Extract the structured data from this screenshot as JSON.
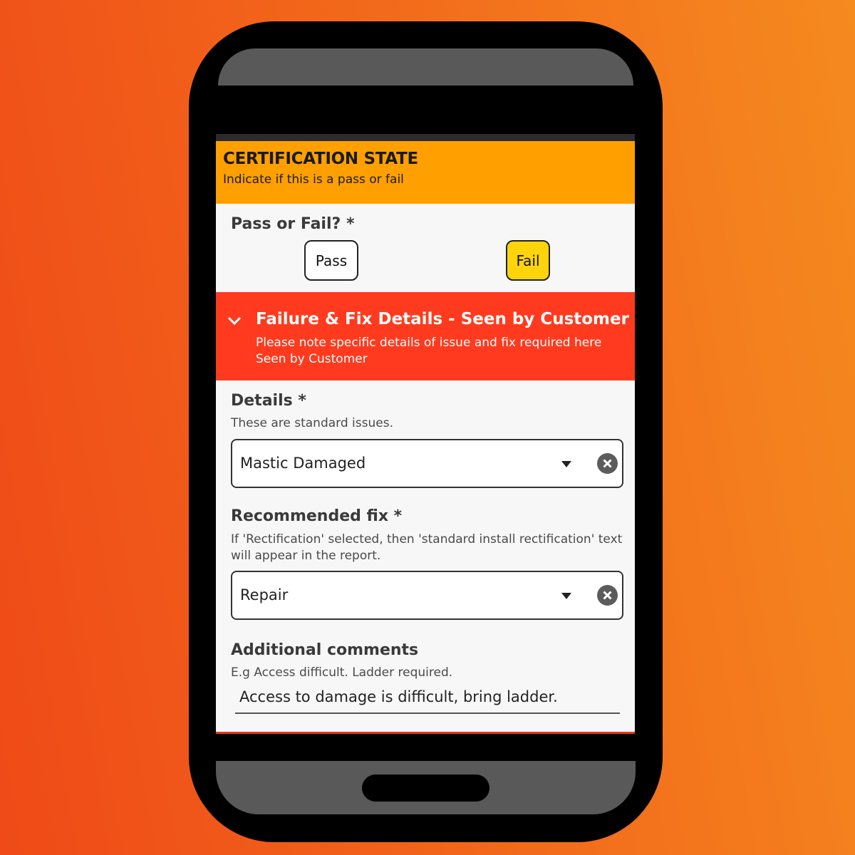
{
  "certification": {
    "title": "CERTIFICATION STATE",
    "subtitle": "Indicate if this is a pass or fail"
  },
  "pass_fail": {
    "label": "Pass or Fail? *",
    "pass_label": "Pass",
    "fail_label": "Fail",
    "selected": "Fail"
  },
  "failure_section": {
    "title": "Failure & Fix Details - Seen by Customer",
    "subtitle_line1": "Please note specific details of issue and fix required here",
    "subtitle_line2": "Seen by Customer",
    "expanded": true
  },
  "details": {
    "label": "Details *",
    "hint": "These are standard issues.",
    "value": "Mastic Damaged"
  },
  "recommended_fix": {
    "label": "Recommended fix *",
    "hint": "If 'Rectification' selected, then 'standard install rectification' text will appear in the report.",
    "value": "Repair"
  },
  "additional_comments": {
    "label": "Additional comments",
    "hint": "E.g Access difficult. Ladder required.",
    "value": "Access to damage is difficult, bring ladder."
  },
  "colors": {
    "background_start": "#ef4a18",
    "background_end": "#f58a1f",
    "certification_header": "#ffa000",
    "failure_header": "#ff3a1e",
    "fail_selected": "#ffd40a"
  },
  "icons": {
    "section_toggle": "chevron-down-icon",
    "dropdown": "caret-down-icon",
    "clear": "clear-circle-icon"
  }
}
